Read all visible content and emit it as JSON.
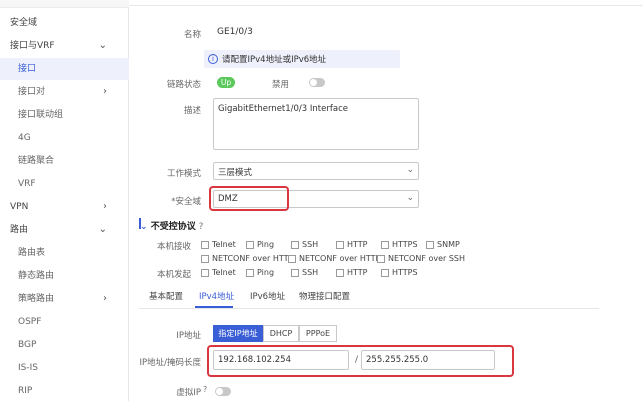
{
  "sidebar": {
    "items": [
      {
        "label": "安全域",
        "level": "top",
        "chevron": ""
      },
      {
        "label": "接口与VRF",
        "level": "top",
        "chevron": "⌄"
      },
      {
        "label": "接口",
        "level": "sub",
        "chevron": "",
        "active": true
      },
      {
        "label": "接口对",
        "level": "sub",
        "chevron": "›"
      },
      {
        "label": "接口联动组",
        "level": "sub",
        "chevron": ""
      },
      {
        "label": "4G",
        "level": "sub",
        "chevron": ""
      },
      {
        "label": "链路聚合",
        "level": "sub",
        "chevron": ""
      },
      {
        "label": "VRF",
        "level": "sub",
        "chevron": ""
      },
      {
        "label": "VPN",
        "level": "top",
        "chevron": "›"
      },
      {
        "label": "路由",
        "level": "top",
        "chevron": "⌄"
      },
      {
        "label": "路由表",
        "level": "sub",
        "chevron": ""
      },
      {
        "label": "静态路由",
        "level": "sub",
        "chevron": ""
      },
      {
        "label": "策略路由",
        "level": "sub",
        "chevron": "›"
      },
      {
        "label": "OSPF",
        "level": "sub",
        "chevron": ""
      },
      {
        "label": "BGP",
        "level": "sub",
        "chevron": ""
      },
      {
        "label": "IS-IS",
        "level": "sub",
        "chevron": ""
      },
      {
        "label": "RIP",
        "level": "sub",
        "chevron": ""
      }
    ]
  },
  "form": {
    "name_label": "名称",
    "name_value": "GE1/0/3",
    "notice": "请配置IPv4地址或IPv6地址",
    "link_status_label": "链路状态",
    "link_status_value": "Up",
    "disable_label": "禁用",
    "description_label": "描述",
    "description_value": "GigabitEthernet1/0/3 Interface",
    "work_mode_label": "工作模式",
    "work_mode_value": "三层模式",
    "security_zone_label": "*安全域",
    "security_zone_value": "DMZ"
  },
  "protocols": {
    "title": "不受控协议",
    "local_receive_label": "本机接收",
    "local_send_label": "本机发起",
    "receive_options": [
      "Telnet",
      "Ping",
      "SSH",
      "HTTP",
      "HTTPS",
      "SNMP"
    ],
    "receive_options_row2": [
      "NETCONF over HTTP",
      "NETCONF over HTTPS",
      "NETCONF over SSH"
    ],
    "send_options": [
      "Telnet",
      "Ping",
      "SSH",
      "HTTP",
      "HTTPS"
    ]
  },
  "tabs": [
    "基本配置",
    "IPv4地址",
    "IPv6地址",
    "物理接口配置"
  ],
  "ipv4": {
    "ip_label": "IP地址",
    "modes": [
      "指定IP地址",
      "DHCP",
      "PPPoE"
    ],
    "addr_mask_label": "IP地址/掩码长度",
    "ip_value": "192.168.102.254",
    "separator": "/",
    "mask_value": "255.255.255.0",
    "virtual_ip_label": "虚拟IP"
  },
  "colors": {
    "accent": "#3a5ed6",
    "highlight": "#d9363e",
    "status_up": "#5ac85a"
  }
}
